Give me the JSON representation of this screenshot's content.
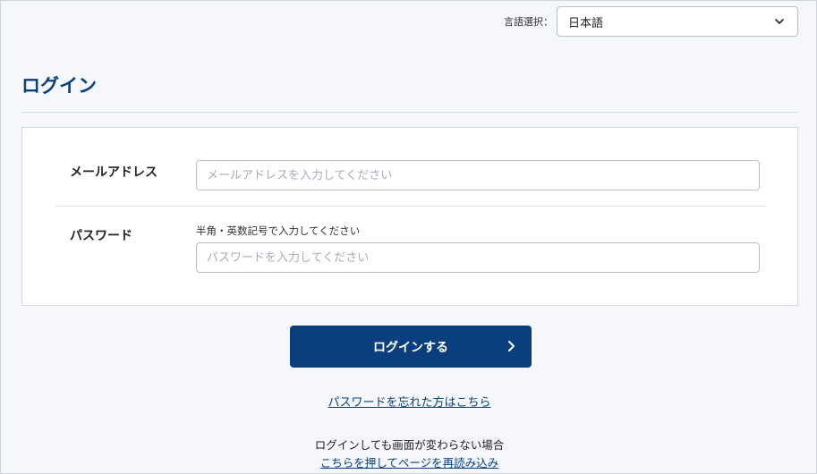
{
  "language": {
    "label": "言語選択：",
    "selected": "日本語"
  },
  "page": {
    "title": "ログイン"
  },
  "form": {
    "email": {
      "label": "メールアドレス",
      "placeholder": "メールアドレスを入力してください",
      "value": ""
    },
    "password": {
      "label": "パスワード",
      "hint": "半角・英数記号で入力してください",
      "placeholder": "パスワードを入力してください",
      "value": ""
    }
  },
  "actions": {
    "login_label": "ログインする",
    "forgot_label": "パスワードを忘れた方はこちら",
    "note_text": "ログインしても画面が変わらない場合",
    "reload_label": "こちらを押してページを再読み込み"
  },
  "colors": {
    "brand": "#0a3f7e",
    "background": "#f5f7fa"
  },
  "icons": {
    "dropdown": "chevron-down-icon",
    "login_arrow": "chevron-right-icon"
  }
}
